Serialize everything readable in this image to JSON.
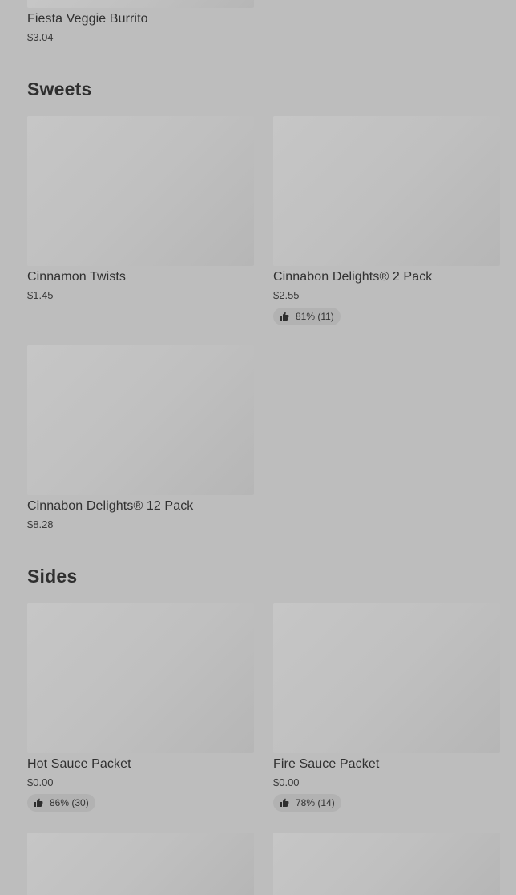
{
  "sections": {
    "top": {
      "items": [
        {
          "name": "Fiesta Veggie Burrito",
          "price": "$3.04"
        }
      ]
    },
    "sweets": {
      "title": "Sweets",
      "items": [
        {
          "name": "Cinnamon Twists",
          "price": "$1.45"
        },
        {
          "name": "Cinnabon Delights® 2 Pack",
          "price": "$2.55",
          "rating": "81% (11)"
        },
        {
          "name": "Cinnabon Delights® 12 Pack",
          "price": "$8.28"
        }
      ]
    },
    "sides": {
      "title": "Sides",
      "items": [
        {
          "name": "Hot Sauce Packet",
          "price": "$0.00",
          "rating": "86% (30)"
        },
        {
          "name": "Fire Sauce Packet",
          "price": "$0.00",
          "rating": "78% (14)"
        }
      ]
    }
  },
  "icons": {
    "rating": "thumbs-up-icon"
  }
}
